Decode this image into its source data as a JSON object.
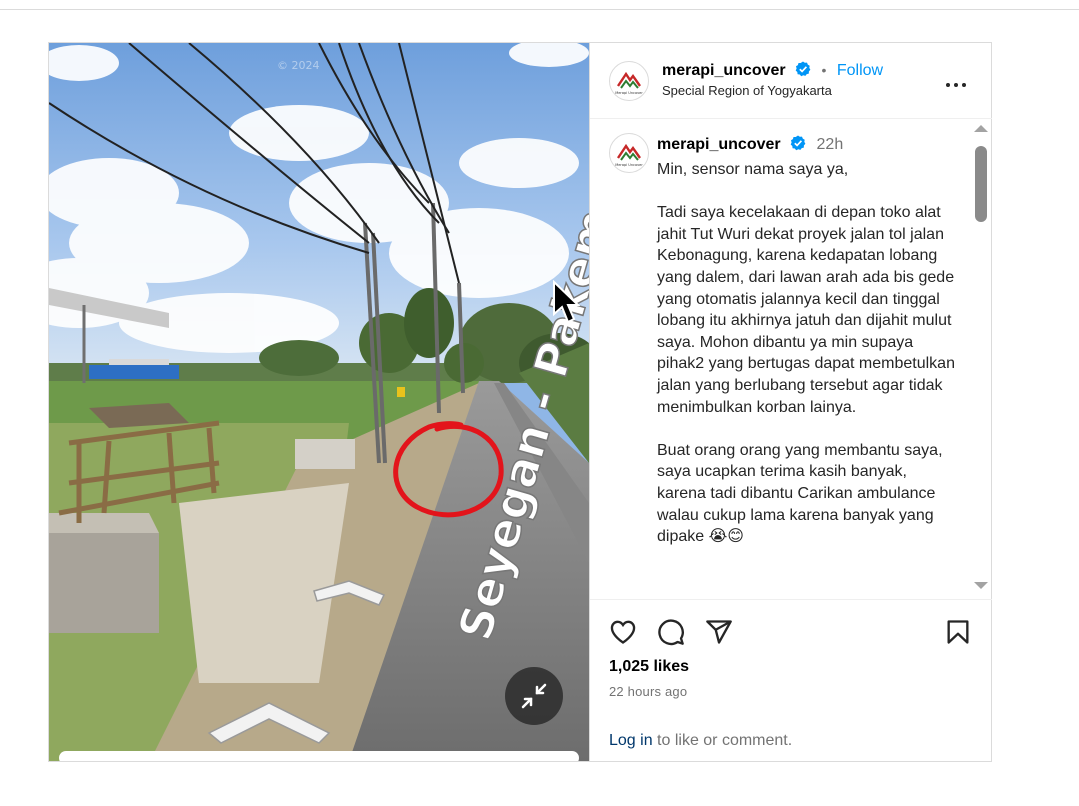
{
  "account": {
    "username": "merapi_uncover",
    "avatar_caption": "Merapi Uncover",
    "follow_label": "Follow",
    "separator": "•",
    "location": "Special Region of Yogyakarta"
  },
  "photo": {
    "street_label": "Seyegan - Pakem",
    "watermark": "© 2024",
    "annotation": "red circle drawn around road hole"
  },
  "caption": {
    "username": "merapi_uncover",
    "time": "22h",
    "text": "Min, sensor nama saya ya,\n\nTadi saya kecelakaan di depan toko alat jahit Tut Wuri dekat proyek jalan tol jalan Kebonagung, karena kedapatan lobang yang dalem, dari lawan arah ada bis gede yang otomatis jalannya kecil dan tinggal lobang itu akhirnya jatuh dan dijahit mulut saya. Mohon dibantu ya min supaya pihak2 yang bertugas dapat membetulkan jalan yang berlubang tersebut agar tidak menimbulkan korban lainya.\n\nBuat orang orang yang membantu saya, saya ucapkan terima kasih banyak, karena tadi dibantu Carikan ambulance walau cukup lama karena banyak yang dipake 😭😊"
  },
  "stats": {
    "likes": "1,025 likes",
    "posted": "22 hours ago"
  },
  "login_prompt": {
    "link": "Log in",
    "rest": " to like or comment."
  },
  "colors": {
    "accent": "#0095f6",
    "verified": "#0095f6",
    "annotation_red": "#e3141b"
  },
  "icons": [
    "verified-icon",
    "more-icon",
    "heart-icon",
    "comment-icon",
    "share-icon",
    "bookmark-icon",
    "shrink-icon",
    "cursor-icon"
  ]
}
